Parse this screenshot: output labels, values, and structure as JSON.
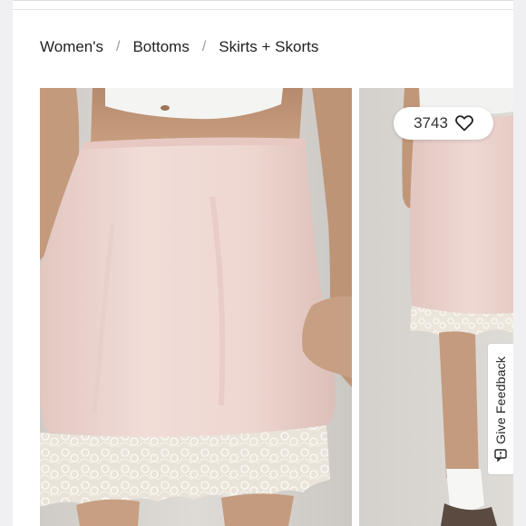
{
  "breadcrumb": {
    "items": [
      "Women's",
      "Bottoms",
      "Skirts + Skorts"
    ],
    "separator": "/"
  },
  "gallery": {
    "images": [
      {
        "alt": "Pink satin slip skirt with lace hem, front view"
      },
      {
        "alt": "Pink satin slip skirt with lace hem, side view"
      }
    ]
  },
  "likes": {
    "count": "3743",
    "icon": "heart-icon"
  },
  "feedback": {
    "label": "Give Feedback",
    "icon": "feedback-icon"
  },
  "colors": {
    "skirt": "#efd7d2",
    "lace": "#f2ede4",
    "background": "#d9d6d2"
  }
}
